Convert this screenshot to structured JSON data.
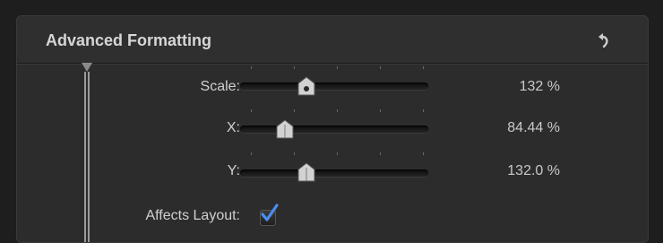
{
  "panel": {
    "title": "Advanced Formatting",
    "reset_icon": "reset-undo-arrow-icon"
  },
  "rows": [
    {
      "label": "Scale:",
      "value": "132 %",
      "slider_fraction": 0.35
    },
    {
      "label": "X:",
      "value": "84.44  %",
      "slider_fraction": 0.24
    },
    {
      "label": "Y:",
      "value": "132.0  %",
      "slider_fraction": 0.35
    }
  ],
  "affects_layout": {
    "label": "Affects Layout:",
    "checked": true
  },
  "colors": {
    "checkmark": "#4a8ef0",
    "panel_bg": "#2c2c2c"
  }
}
